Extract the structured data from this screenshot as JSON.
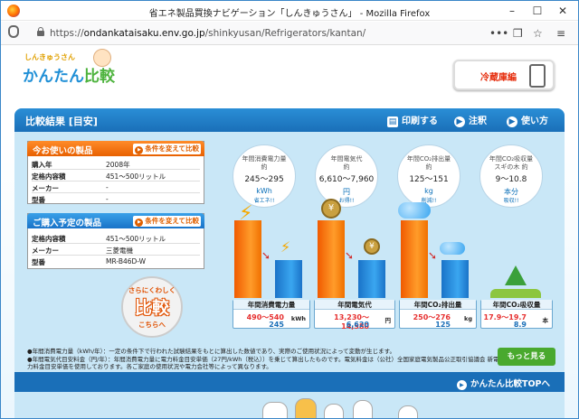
{
  "window": {
    "title": "省エネ製品買換ナビゲーション「しんきゅうさん」 - Mozilla Firefox",
    "min": "–",
    "max": "☐",
    "close": "✕"
  },
  "nav": {
    "back": "←",
    "forward": "→",
    "url_prefix": "https://",
    "url_domain": "ondankataisaku.env.go.jp",
    "url_path": "/shinkyusan/Refrigerators/kantan/",
    "more": "•••",
    "pocket": "❒",
    "star": "☆",
    "menu": "≡"
  },
  "brand": {
    "sub": "しんきゅうさん",
    "main_a": "かんたん",
    "main_b": "比較"
  },
  "category_button": "冷蔵庫編",
  "header": {
    "title": "比較結果 [目安]",
    "print": "印刷する",
    "notes": "注釈",
    "howto": "使い方"
  },
  "current": {
    "label": "今お使いの製品",
    "change": "条件を変えて比較",
    "rows": [
      {
        "k": "購入年",
        "v": "2008年"
      },
      {
        "k": "定格内容積",
        "v": "451～500リットル"
      },
      {
        "k": "メーカー",
        "v": "-"
      },
      {
        "k": "型番",
        "v": "-"
      }
    ]
  },
  "planned": {
    "label": "ご購入予定の製品",
    "change": "条件を変えて比較",
    "rows": [
      {
        "k": "定格内容積",
        "v": "451～500リットル"
      },
      {
        "k": "メーカー",
        "v": "三菱電機"
      },
      {
        "k": "型番",
        "v": "MR-B46D-W"
      }
    ]
  },
  "compare_button": {
    "a": "さらにくわしく",
    "b": "比較",
    "c": "こちらへ"
  },
  "bubbles": [
    {
      "l1": "年間消費電力量",
      "l2": "約",
      "v": "245～295",
      "u": "kWh",
      "n": "省エネ!!"
    },
    {
      "l1": "年間電気代",
      "l2": "約",
      "v": "6,610～7,960",
      "u": "円",
      "n": "お得!!"
    },
    {
      "l1": "年間CO₂排出量",
      "l2": "約",
      "v": "125～151",
      "u": "kg",
      "n": "削減!!"
    },
    {
      "l1": "年間CO₂吸収量",
      "l2": "スギの木 約",
      "v": "9～10.8",
      "u": "本分",
      "n": "吸収!!"
    }
  ],
  "results": [
    {
      "cap": "年間消費電力量",
      "old": "490～540",
      "new": "245",
      "unit": "kWh"
    },
    {
      "cap": "年間電気代",
      "old": "13,230～14,580",
      "new": "6,620",
      "unit": "円"
    },
    {
      "cap": "年間CO₂排出量",
      "old": "250～276",
      "new": "125",
      "unit": "kg"
    },
    {
      "cap": "年間CO₂吸収量",
      "old": "17.9～19.7",
      "new": "8.9",
      "unit": "本"
    }
  ],
  "notes": [
    "●年間消費電力量（kWh/年）：一定の条件下で行われた試験結果をもとに算出した数値であり、実際のご使用状況によって変動が生じます。",
    "●年間電気代目安料金（円/年）：年間消費電力量に電力料金目安単価（27円/kWh（税込））を乗じて算出したものです。電気料金は（公社）全国家庭電気製品公正取引協議会 新電力料金目安単価を使用しております。各ご家庭の使用状況や電力会社等によって異なります。"
  ],
  "more_button": "もっと見る",
  "footer_link": "かんたん比較TOPへ"
}
